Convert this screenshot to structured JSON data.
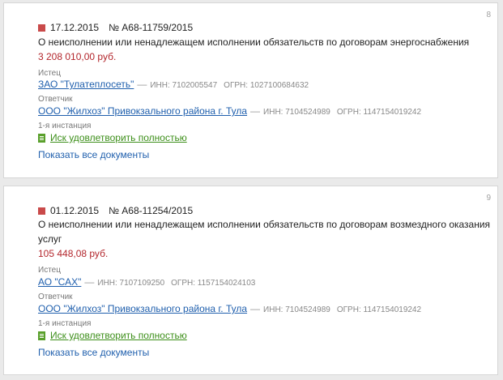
{
  "cases": [
    {
      "index": "8",
      "date": "17.12.2015",
      "case_no": "№ А68-11759/2015",
      "subject": "О неисполнении или ненадлежащем исполнении обязательств по договорам энергоснабжения",
      "amount": "3 208 010,00 руб.",
      "plaintiff_label": "Истец",
      "plaintiff": {
        "name": "ЗАО \"Тулатеплосеть\"",
        "inn": "ИНН: 7102005547",
        "ogrn": "ОГРН: 1027100684632"
      },
      "defendant_label": "Ответчик",
      "defendant": {
        "name": "ООО \"Жилхоз\" Привокзального района г. Тула",
        "inn": "ИНН: 7104524989",
        "ogrn": "ОГРН: 1147154019242"
      },
      "instance_label": "1-я инстанция",
      "result": "Иск удовлетворить полностью",
      "show_all": "Показать все документы"
    },
    {
      "index": "9",
      "date": "01.12.2015",
      "case_no": "№ А68-11254/2015",
      "subject_line1": "О неисполнении или ненадлежащем исполнении обязательств по договорам возмездного оказания",
      "subject_line2": "услуг",
      "amount": "105 448,08 руб.",
      "plaintiff_label": "Истец",
      "plaintiff": {
        "name": "АО \"САХ\"",
        "inn": "ИНН: 7107109250",
        "ogrn": "ОГРН: 1157154024103"
      },
      "defendant_label": "Ответчик",
      "defendant": {
        "name": "ООО \"Жилхоз\" Привокзального района г. Тула",
        "inn": "ИНН: 7104524989",
        "ogrn": "ОГРН: 1147154019242"
      },
      "instance_label": "1-я инстанция",
      "result": "Иск удовлетворить полностью",
      "show_all": "Показать все документы"
    }
  ],
  "colors": {
    "marker": "#c94a4a",
    "amount": "#b3262c",
    "link": "#1f5fad",
    "result": "#3d8f1a"
  },
  "icons": {
    "marker": "red-square-marker-icon",
    "result": "document-icon"
  }
}
